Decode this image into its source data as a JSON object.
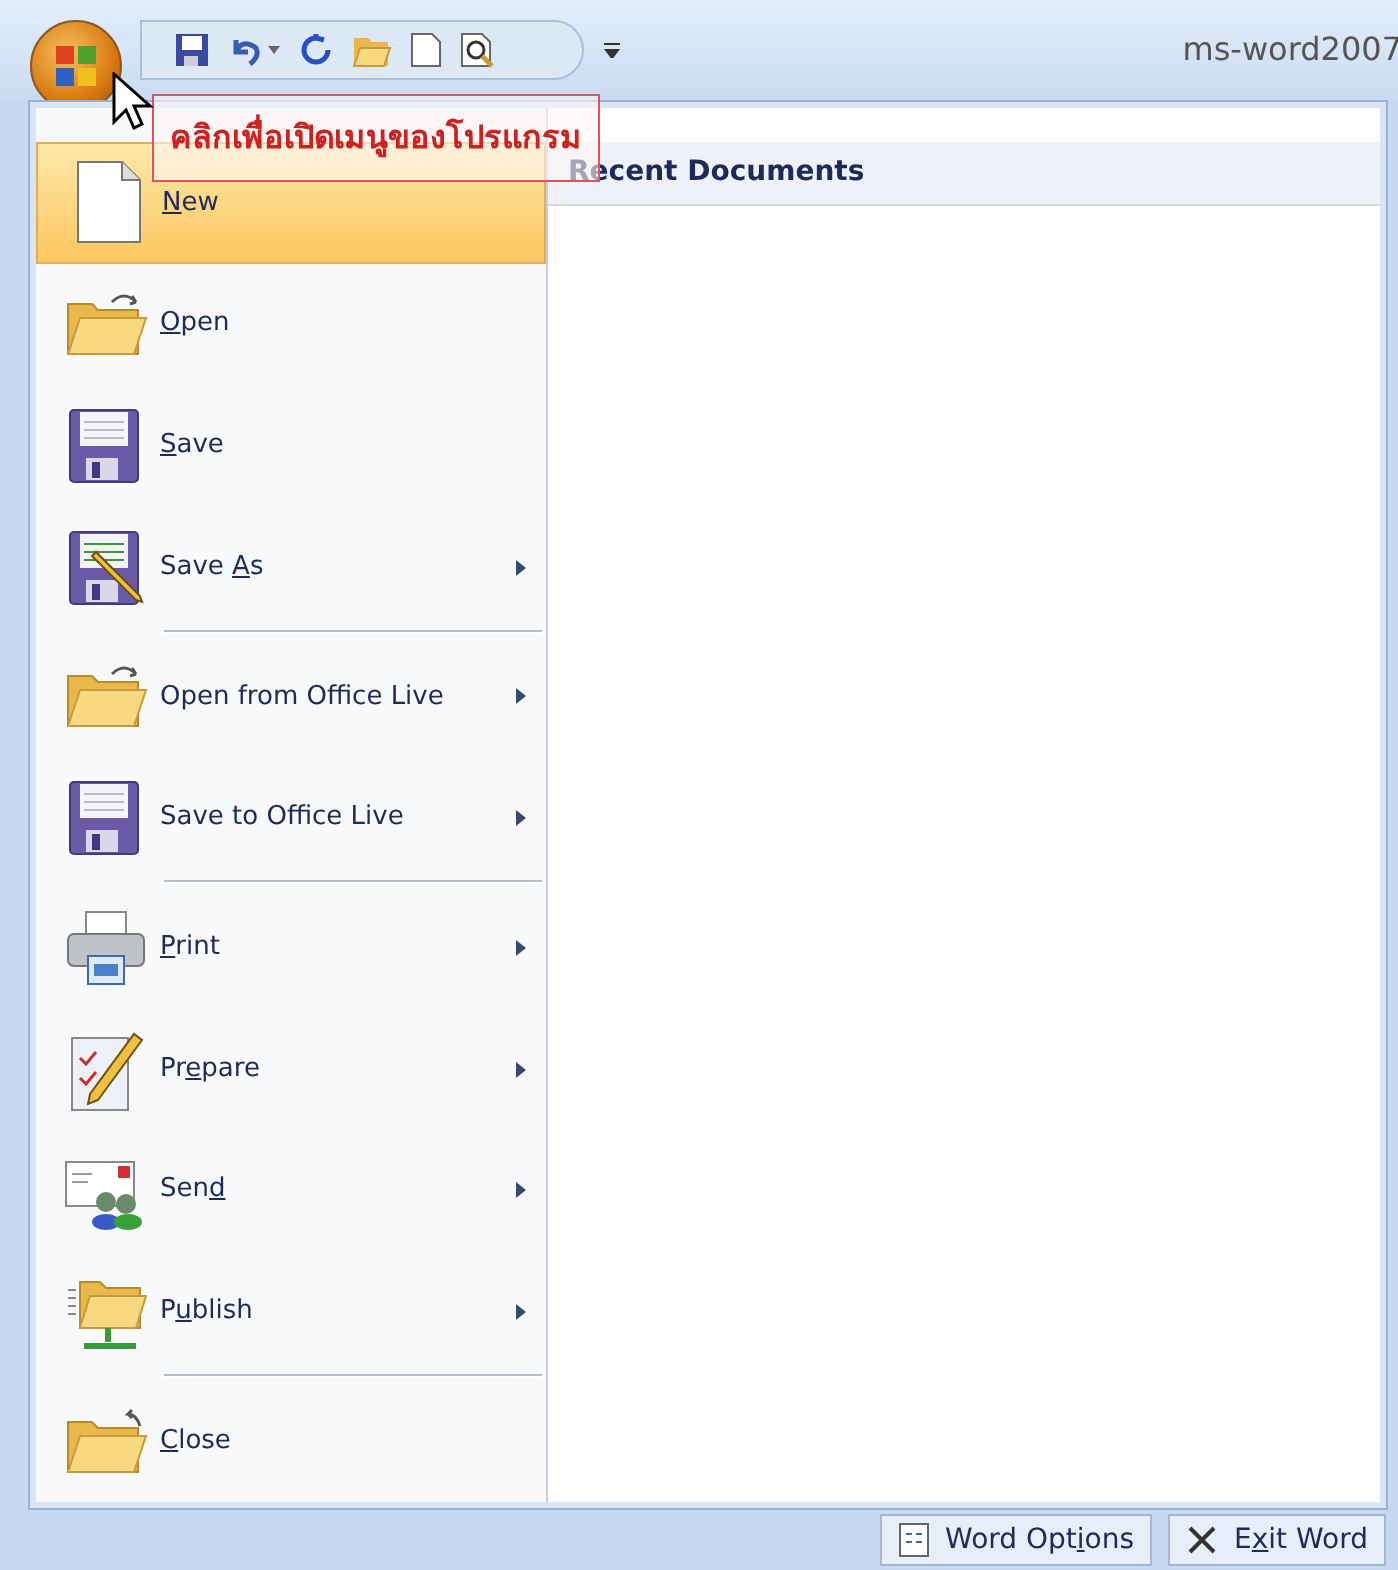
{
  "title_bar": {
    "title": "ms-word2007"
  },
  "tooltip": {
    "text": "คลิกเพื่อเปิดเมนูของโปรแกรม"
  },
  "menu": {
    "items": [
      {
        "kind": "item",
        "access_key": "N",
        "label_after": "ew",
        "has_submenu": false,
        "selected": true
      },
      {
        "kind": "item",
        "access_key": "O",
        "label_after": "pen",
        "has_submenu": false,
        "selected": false
      },
      {
        "kind": "item",
        "access_key": "S",
        "label_after": "ave",
        "has_submenu": false,
        "selected": false
      },
      {
        "kind": "item",
        "label_before": "Save ",
        "access_key": "A",
        "label_after": "s",
        "has_submenu": true,
        "selected": false
      },
      {
        "kind": "separator"
      },
      {
        "kind": "item",
        "label_before": "Open from Office Live",
        "has_submenu": true,
        "selected": false
      },
      {
        "kind": "item",
        "label_before": "Save to Office Live",
        "has_submenu": true,
        "selected": false
      },
      {
        "kind": "separator"
      },
      {
        "kind": "item",
        "access_key": "P",
        "label_after": "rint",
        "has_submenu": true,
        "selected": false
      },
      {
        "kind": "item",
        "label_before": "Pr",
        "access_key": "e",
        "label_after": "pare",
        "has_submenu": true,
        "selected": false
      },
      {
        "kind": "item",
        "label_before": "Sen",
        "access_key": "d",
        "has_submenu": true,
        "selected": false
      },
      {
        "kind": "item",
        "label_before": "P",
        "access_key": "u",
        "label_after": "blish",
        "has_submenu": true,
        "selected": false
      },
      {
        "kind": "separator"
      },
      {
        "kind": "item",
        "access_key": "C",
        "label_after": "lose",
        "has_submenu": false,
        "selected": false
      }
    ]
  },
  "recent": {
    "heading": "Recent Documents"
  },
  "footer_buttons": [
    {
      "label_before": "Word Opt",
      "access_key": "i",
      "label_after": "ons"
    },
    {
      "label_before": "E",
      "access_key": "x",
      "label_after": "it Word"
    }
  ]
}
